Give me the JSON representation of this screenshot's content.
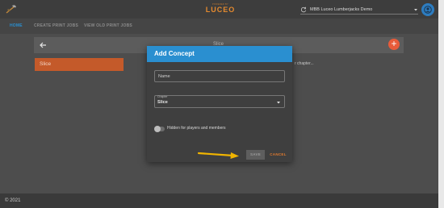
{
  "header": {
    "brand_small": "POWERED BY",
    "brand": "LUCEO",
    "team_selector": "MBB Luceo Lumberjacks Demo",
    "icons": {
      "logo": "axe-logo-icon",
      "sync": "sync-icon",
      "caret": "chevron-down-icon",
      "account": "account-icon"
    }
  },
  "nav": {
    "tabs": [
      "HOME",
      "CREATE PRINT JOBS",
      "VIEW OLD PRINT JOBS"
    ]
  },
  "main": {
    "panel_title": "Slice",
    "add_icon": "+",
    "concept_item": "Slice",
    "hint_text": "r chapter..."
  },
  "dialog": {
    "title": "Add Concept",
    "name_placeholder": "Name",
    "chapter_label": "Chapter",
    "chapter_value": "Slice",
    "toggle_label": "Hidden for players and members",
    "save_label": "SAVE",
    "cancel_label": "CANCEL"
  },
  "footer": {
    "copyright": "© 2021"
  },
  "colors": {
    "accent_blue": "#2a8fd0",
    "accent_orange": "#e07a2e",
    "fab_red": "#e85b3a",
    "concept_orange": "#c45a2a",
    "arrow_yellow": "#f0b400"
  }
}
